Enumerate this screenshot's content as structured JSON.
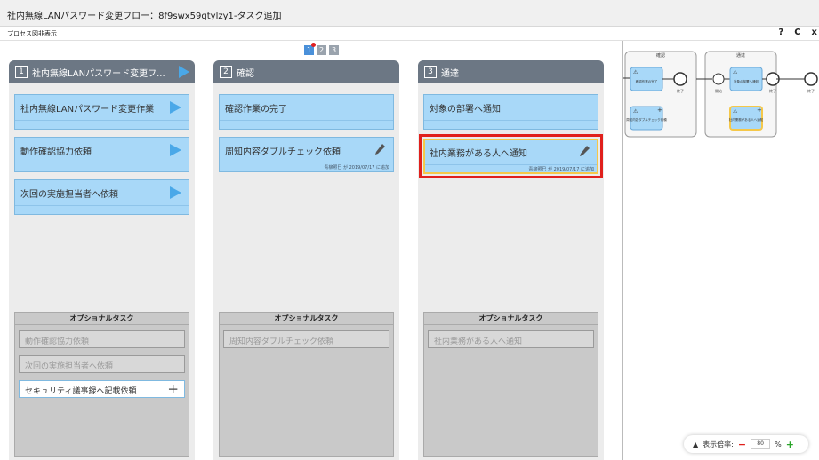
{
  "window": {
    "title": "社内無線LANパスワード変更フロー：8f9swx59gtylzy1-タスク追加",
    "process_toggle": "プロセス図非表示",
    "help_icon": "?",
    "refresh_icon": "C"
  },
  "pager": [
    "1",
    "2",
    "3"
  ],
  "columns": [
    {
      "number": "1",
      "name": "社内無線LANパスワード変更フ...",
      "cards": [
        {
          "title": "社内無線LANパスワード変更作業"
        },
        {
          "title": "動作確認協力依頼"
        },
        {
          "title": "次回の実施担当者へ依頼"
        }
      ],
      "optional": {
        "header": "オプショナルタスク",
        "items": [
          "動作確認協力依頼",
          "次回の実施担当者へ依頼",
          "セキュリティ議事録へ記載依頼"
        ]
      }
    },
    {
      "number": "2",
      "name": "確認",
      "cards": [
        {
          "title": "確認作業の完了"
        },
        {
          "title": "周知内容ダブルチェック依頼",
          "meta": "青柳照巳 が 2019/07/17 に追加"
        }
      ],
      "optional": {
        "header": "オプショナルタスク",
        "items": [
          "周知内容ダブルチェック依頼"
        ]
      }
    },
    {
      "number": "3",
      "name": "通達",
      "cards": [
        {
          "title": "対象の部署へ通知"
        },
        {
          "title": "社内業務がある人へ通知",
          "meta": "青柳照巳 が 2019/07/17 に追加"
        }
      ],
      "optional": {
        "header": "オプショナルタスク",
        "items": [
          "社内業務がある人へ通知"
        ]
      }
    }
  ],
  "diagram": {
    "lane_confirm": "確認",
    "lane_notify": "通達",
    "task_confirm_done": "確認作業の完了",
    "task_double_check": "周知内容ダブルチェック依頼",
    "task_notify_dept": "対象の部署へ通知",
    "task_notify_people": "社内業務がある人へ通知",
    "end_label": "終了",
    "start_label": "開始",
    "warning_icon": "⚠"
  },
  "zoom": {
    "label": "表示倍率:",
    "value": "80",
    "unit": "%",
    "minus": "−",
    "plus": "+",
    "arrow": "▲"
  },
  "colors": {
    "card": "#a8d8f8",
    "column_header": "#6c7784",
    "selected_outline": "#e0201c",
    "selected_inner": "#f5c84a",
    "play_icon": "#4aa8e8"
  }
}
